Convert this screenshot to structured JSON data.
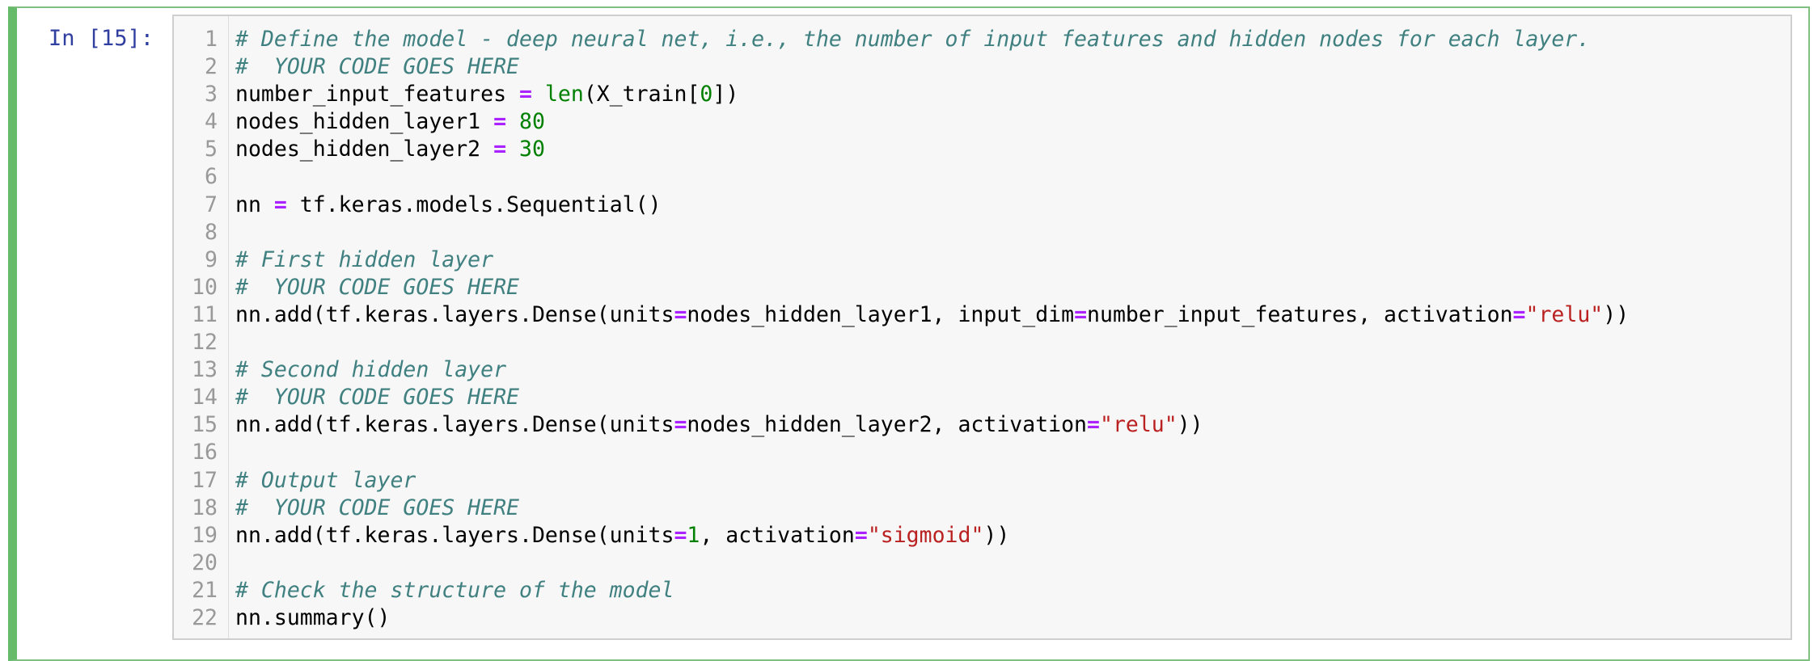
{
  "prompt": "In [15]:",
  "code_lines": [
    {
      "n": "1",
      "tokens": [
        {
          "t": "cm",
          "v": "# Define the model - deep neural net, i.e., the number of input features and hidden nodes for each layer."
        }
      ]
    },
    {
      "n": "2",
      "tokens": [
        {
          "t": "cm",
          "v": "#  YOUR CODE GOES HERE"
        }
      ]
    },
    {
      "n": "3",
      "tokens": [
        {
          "t": "",
          "v": "number_input_features "
        },
        {
          "t": "op",
          "v": "="
        },
        {
          "t": "",
          "v": " "
        },
        {
          "t": "bi",
          "v": "len"
        },
        {
          "t": "",
          "v": "(X_train["
        },
        {
          "t": "num",
          "v": "0"
        },
        {
          "t": "",
          "v": "])"
        }
      ]
    },
    {
      "n": "4",
      "tokens": [
        {
          "t": "",
          "v": "nodes_hidden_layer1 "
        },
        {
          "t": "op",
          "v": "="
        },
        {
          "t": "",
          "v": " "
        },
        {
          "t": "num",
          "v": "80"
        }
      ]
    },
    {
      "n": "5",
      "tokens": [
        {
          "t": "",
          "v": "nodes_hidden_layer2 "
        },
        {
          "t": "op",
          "v": "="
        },
        {
          "t": "",
          "v": " "
        },
        {
          "t": "num",
          "v": "30"
        }
      ]
    },
    {
      "n": "6",
      "tokens": []
    },
    {
      "n": "7",
      "tokens": [
        {
          "t": "",
          "v": "nn "
        },
        {
          "t": "op",
          "v": "="
        },
        {
          "t": "",
          "v": " tf.keras.models.Sequential()"
        }
      ]
    },
    {
      "n": "8",
      "tokens": []
    },
    {
      "n": "9",
      "tokens": [
        {
          "t": "cm",
          "v": "# First hidden layer"
        }
      ]
    },
    {
      "n": "10",
      "tokens": [
        {
          "t": "cm",
          "v": "#  YOUR CODE GOES HERE"
        }
      ]
    },
    {
      "n": "11",
      "tokens": [
        {
          "t": "",
          "v": "nn.add(tf.keras.layers.Dense(units"
        },
        {
          "t": "op",
          "v": "="
        },
        {
          "t": "",
          "v": "nodes_hidden_layer1, input_dim"
        },
        {
          "t": "op",
          "v": "="
        },
        {
          "t": "",
          "v": "number_input_features, activation"
        },
        {
          "t": "op",
          "v": "="
        },
        {
          "t": "str",
          "v": "\"relu\""
        },
        {
          "t": "",
          "v": "))"
        }
      ]
    },
    {
      "n": "12",
      "tokens": []
    },
    {
      "n": "13",
      "tokens": [
        {
          "t": "cm",
          "v": "# Second hidden layer"
        }
      ]
    },
    {
      "n": "14",
      "tokens": [
        {
          "t": "cm",
          "v": "#  YOUR CODE GOES HERE"
        }
      ]
    },
    {
      "n": "15",
      "tokens": [
        {
          "t": "",
          "v": "nn.add(tf.keras.layers.Dense(units"
        },
        {
          "t": "op",
          "v": "="
        },
        {
          "t": "",
          "v": "nodes_hidden_layer2, activation"
        },
        {
          "t": "op",
          "v": "="
        },
        {
          "t": "str",
          "v": "\"relu\""
        },
        {
          "t": "",
          "v": "))"
        }
      ]
    },
    {
      "n": "16",
      "tokens": []
    },
    {
      "n": "17",
      "tokens": [
        {
          "t": "cm",
          "v": "# Output layer"
        }
      ]
    },
    {
      "n": "18",
      "tokens": [
        {
          "t": "cm",
          "v": "#  YOUR CODE GOES HERE"
        }
      ]
    },
    {
      "n": "19",
      "tokens": [
        {
          "t": "",
          "v": "nn.add(tf.keras.layers.Dense(units"
        },
        {
          "t": "op",
          "v": "="
        },
        {
          "t": "num",
          "v": "1"
        },
        {
          "t": "",
          "v": ", activation"
        },
        {
          "t": "op",
          "v": "="
        },
        {
          "t": "str",
          "v": "\"sigmoid\""
        },
        {
          "t": "",
          "v": "))"
        }
      ]
    },
    {
      "n": "20",
      "tokens": []
    },
    {
      "n": "21",
      "tokens": [
        {
          "t": "cm",
          "v": "# Check the structure of the model"
        }
      ]
    },
    {
      "n": "22",
      "tokens": [
        {
          "t": "",
          "v": "nn.summary()"
        }
      ]
    }
  ],
  "colors": {
    "prompt": "#303f9f",
    "comment": "#408080",
    "operator": "#aa22ff",
    "number": "#008000",
    "string": "#ba2121",
    "cell_selected_border": "#66bb6a"
  }
}
